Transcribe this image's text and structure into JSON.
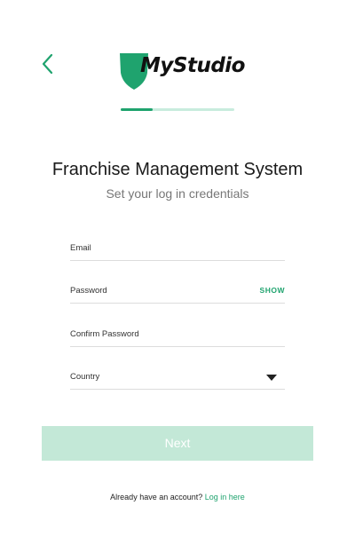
{
  "header": {
    "logo_text": "MyStudio",
    "brand_color": "#1fa36e",
    "back_icon": "chevron-left-icon"
  },
  "progress": {
    "value": 0.28
  },
  "title": "Franchise Management System",
  "subtitle": "Set your log in credentials",
  "form": {
    "email_label": "Email",
    "password_label": "Password",
    "show_label": "SHOW",
    "confirm_label": "Confirm Password",
    "country_label": "Country",
    "country_icon": "caret-down-icon"
  },
  "next_label": "Next",
  "footer": {
    "text": "Already have an account?",
    "link": "Log in here"
  }
}
